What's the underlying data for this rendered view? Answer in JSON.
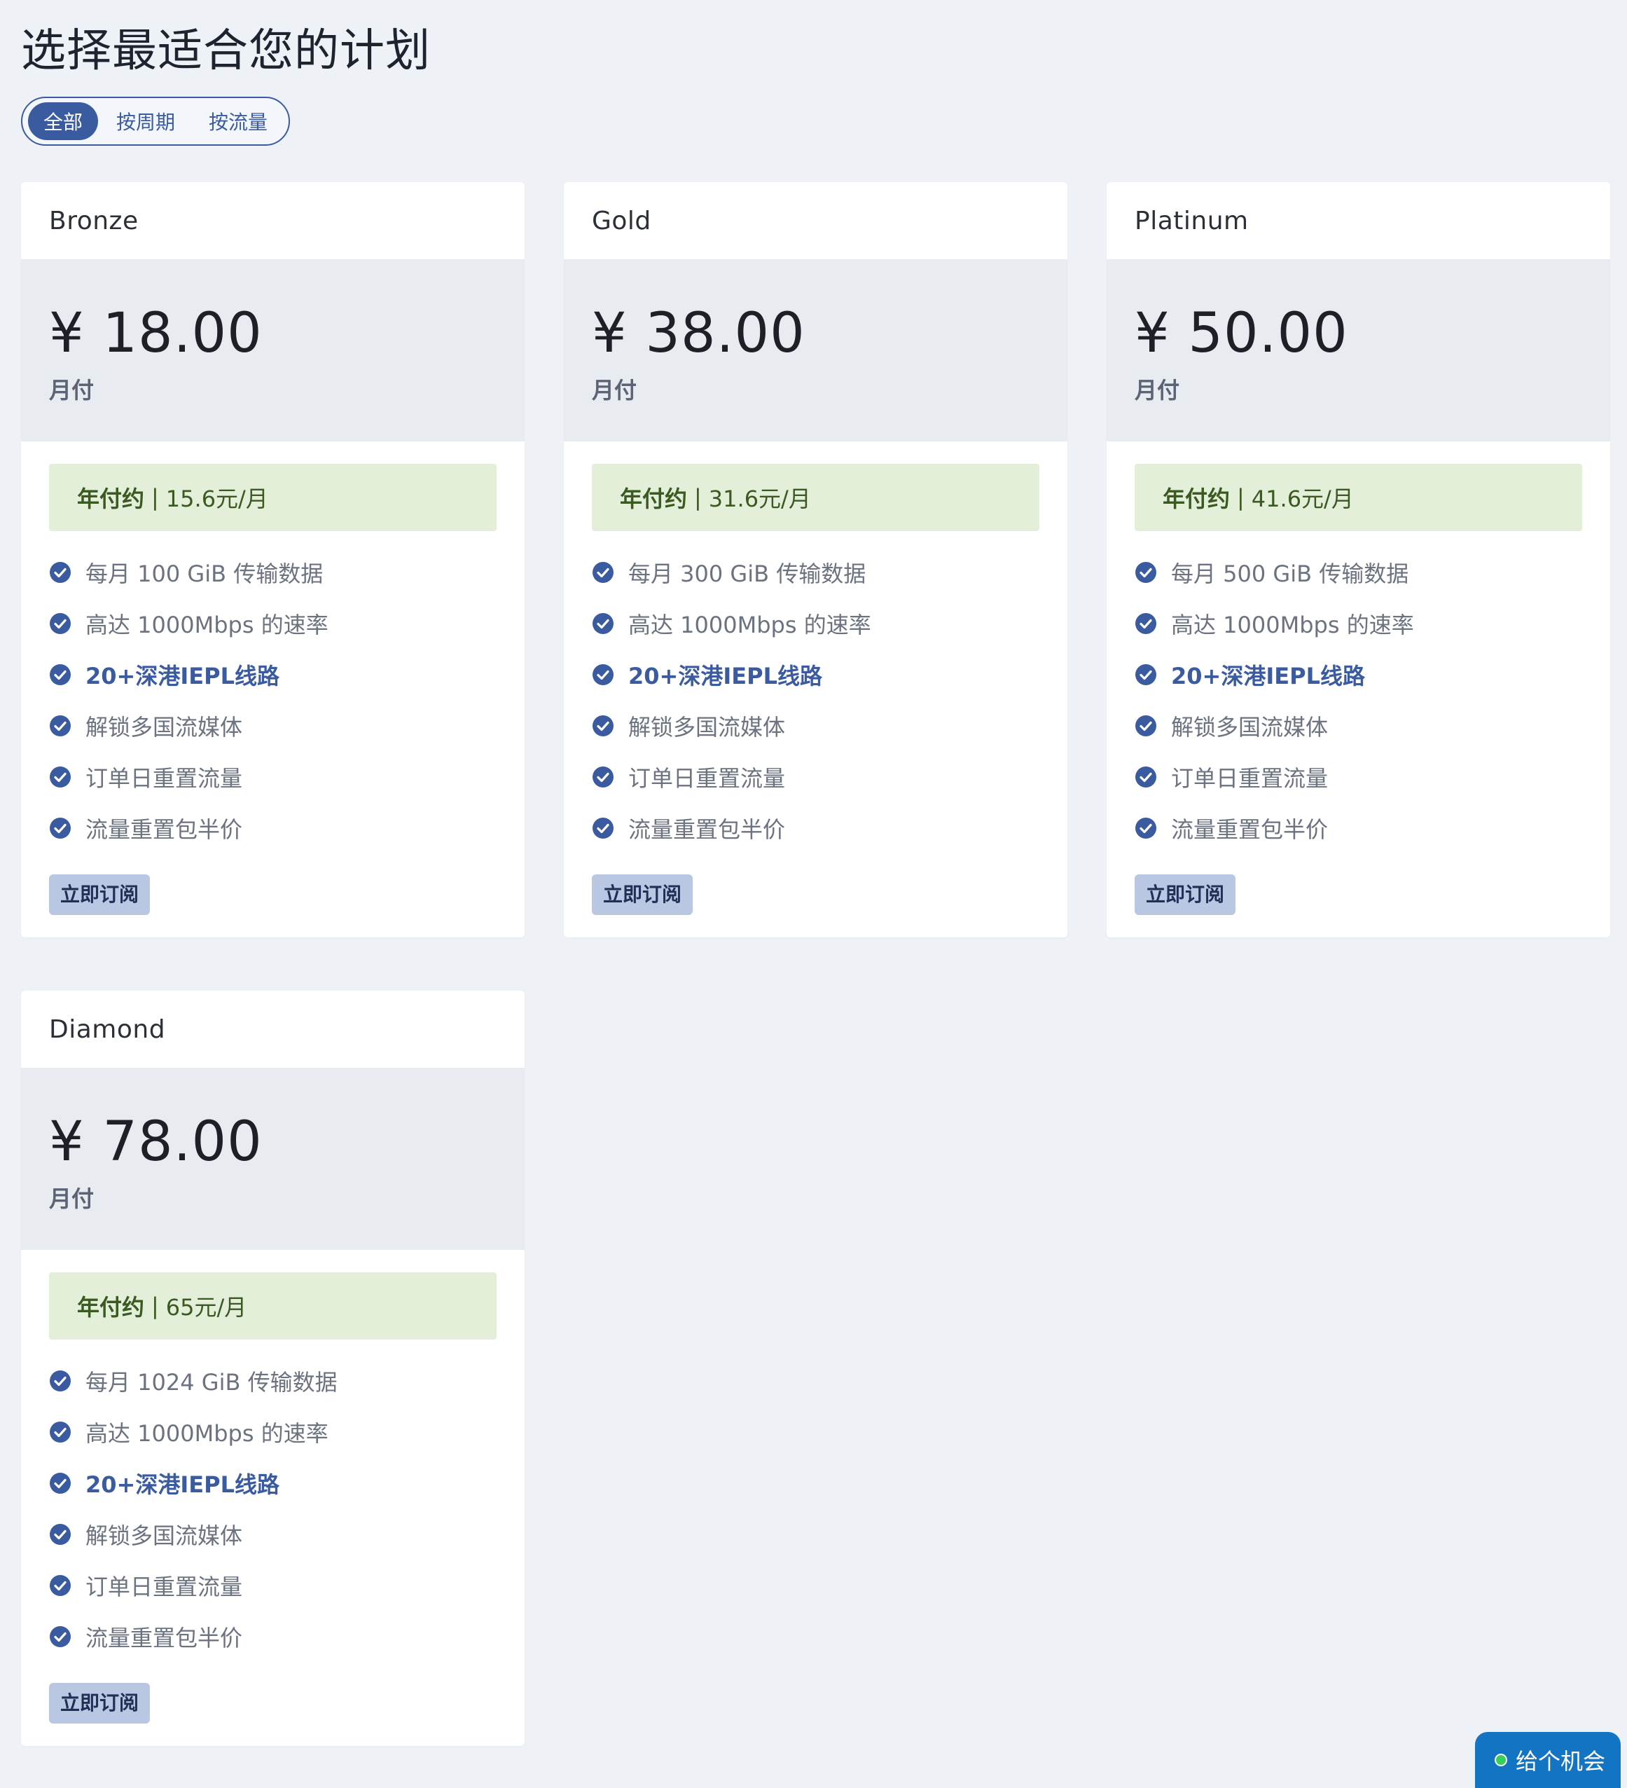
{
  "page": {
    "title": "选择最适合您的计划"
  },
  "filter": {
    "tabs": [
      {
        "label": "全部",
        "active": true
      },
      {
        "label": "按周期",
        "active": false
      },
      {
        "label": "按流量",
        "active": false
      }
    ]
  },
  "colors": {
    "accent": "#3b5ba0",
    "page_bg": "#eef2f7",
    "price_bg": "#e8ecf1",
    "annual_bg": "#e4efd9",
    "annual_text": "#3a5a22",
    "button_bg": "#b9c7e3",
    "chat_bg": "#1474c4",
    "online_dot": "#34d058"
  },
  "plans": [
    {
      "name": "Bronze",
      "price": "¥ 18.00",
      "period": "月付",
      "annual_label": "年付约",
      "annual_price": "15.6元/月",
      "features": [
        "每月 100 GiB 传输数据",
        "高达 1000Mbps 的速率",
        "20+深港IEPL线路",
        "解锁多国流媒体",
        "订单日重置流量",
        "流量重置包半价"
      ],
      "button": "立即订阅"
    },
    {
      "name": "Gold",
      "price": "¥ 38.00",
      "period": "月付",
      "annual_label": "年付约",
      "annual_price": "31.6元/月",
      "features": [
        "每月 300 GiB 传输数据",
        "高达 1000Mbps 的速率",
        "20+深港IEPL线路",
        "解锁多国流媒体",
        "订单日重置流量",
        "流量重置包半价"
      ],
      "button": "立即订阅"
    },
    {
      "name": "Platinum",
      "price": "¥ 50.00",
      "period": "月付",
      "annual_label": "年付约",
      "annual_price": "41.6元/月",
      "features": [
        "每月 500 GiB 传输数据",
        "高达 1000Mbps 的速率",
        "20+深港IEPL线路",
        "解锁多国流媒体",
        "订单日重置流量",
        "流量重置包半价"
      ],
      "button": "立即订阅"
    },
    {
      "name": "Diamond",
      "price": "¥ 78.00",
      "period": "月付",
      "annual_label": "年付约",
      "annual_price": "65元/月",
      "features": [
        "每月 1024 GiB 传输数据",
        "高达 1000Mbps 的速率",
        "20+深港IEPL线路",
        "解锁多国流媒体",
        "订单日重置流量",
        "流量重置包半价"
      ],
      "button": "立即订阅"
    }
  ],
  "chat": {
    "label": "给个机会",
    "icon": "online-dot-icon"
  }
}
